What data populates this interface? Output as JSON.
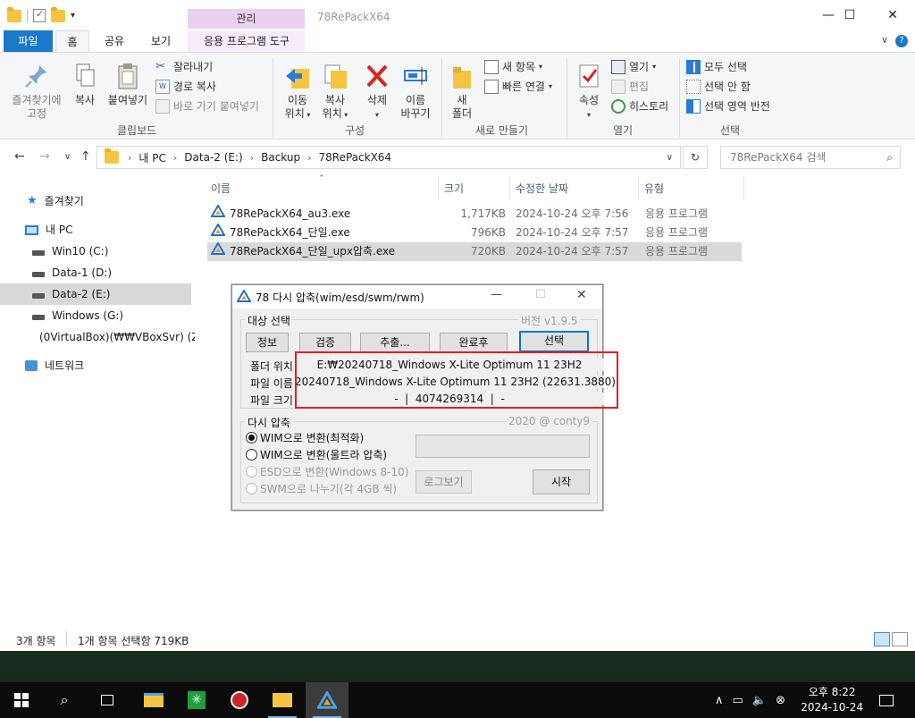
{
  "window": {
    "title": "78RePackX64",
    "context_tab": "관리"
  },
  "ribbon_tabs": [
    "파일",
    "홈",
    "공유",
    "보기",
    "응용 프로그램 도구"
  ],
  "ribbon": {
    "clipboard": {
      "pin": "즐겨찾기에\n고정",
      "copy": "복사",
      "paste": "붙여넣기",
      "cut": "잘라내기",
      "copy_path": "경로 복사",
      "paste_shortcut": "바로 가기 붙여넣기",
      "group": "클립보드"
    },
    "organize": {
      "move_to": "이동\n위치",
      "copy_to": "복사\n위치",
      "delete": "삭제",
      "rename": "이름\n바꾸기",
      "group": "구성"
    },
    "new": {
      "new_folder": "새\n폴더",
      "new_item": "새 항목",
      "easy_access": "빠른 연결",
      "group": "새로 만들기"
    },
    "open": {
      "properties": "속성",
      "open": "열기",
      "edit": "편집",
      "history": "히스토리",
      "group": "열기"
    },
    "select": {
      "select_all": "모두 선택",
      "select_none": "선택 안 함",
      "invert": "선택 영역 반전",
      "group": "선택"
    }
  },
  "address": {
    "crumbs": [
      "내 PC",
      "Data-2 (E:)",
      "Backup",
      "78RePackX64"
    ],
    "search_placeholder": "78RePackX64 검색"
  },
  "nav": {
    "favorites": "즐겨찾기",
    "this_pc": "내 PC",
    "drives": [
      "Win10 (C:)",
      "Data-1 (D:)",
      "Data-2 (E:)",
      "Windows (G:)",
      "(0VirtualBox)(₩₩VBoxSvr) (Z:"
    ],
    "network": "네트워크"
  },
  "columns": {
    "name": "이름",
    "size": "크기",
    "modified": "수정한 날짜",
    "type": "유형"
  },
  "files": [
    {
      "name": "78RePackX64_au3.exe",
      "size": "1,717KB",
      "modified": "2024-10-24 오후 7:56",
      "type": "응용 프로그램"
    },
    {
      "name": "78RePackX64_단일.exe",
      "size": "796KB",
      "modified": "2024-10-24 오후 7:57",
      "type": "응용 프로그램"
    },
    {
      "name": "78RePackX64_단일_upx압축.exe",
      "size": "720KB",
      "modified": "2024-10-24 오후 7:57",
      "type": "응용 프로그램"
    }
  ],
  "status": {
    "count": "3개 항목",
    "selected": "1개 항목 선택함 719KB"
  },
  "dialog": {
    "title": "78 다시 압축(wim/esd/swm/rwm)",
    "target_group": "대상 선택",
    "version": "버전 v1.9.5",
    "buttons": {
      "info": "정보",
      "verify": "검증",
      "extract": "추출...",
      "after": "완료후",
      "select": "선택",
      "log": "로그보기",
      "start": "시작"
    },
    "labels": {
      "folder": "폴더 위치",
      "file": "파일 이름",
      "size": "파일 크기"
    },
    "values": {
      "folder": "E:₩20240718_Windows X-Lite Optimum 11 23H2",
      "file": "20240718_Windows X-Lite Optimum 11 23H2 (22631.3880)",
      "size": "-  |  4074269314  |  -"
    },
    "recompress_group": "다시 압축",
    "credit": "2020 @ conty9",
    "options": [
      "WIM으로 변환(최적화)",
      "WIM으로 변환(울트라 압축)",
      "ESD으로 변환(Windows 8-10)",
      "SWM으로 나누기(각 4GB 씩)"
    ]
  },
  "taskbar": {
    "time": "오후 8:22",
    "date": "2024-10-24"
  }
}
